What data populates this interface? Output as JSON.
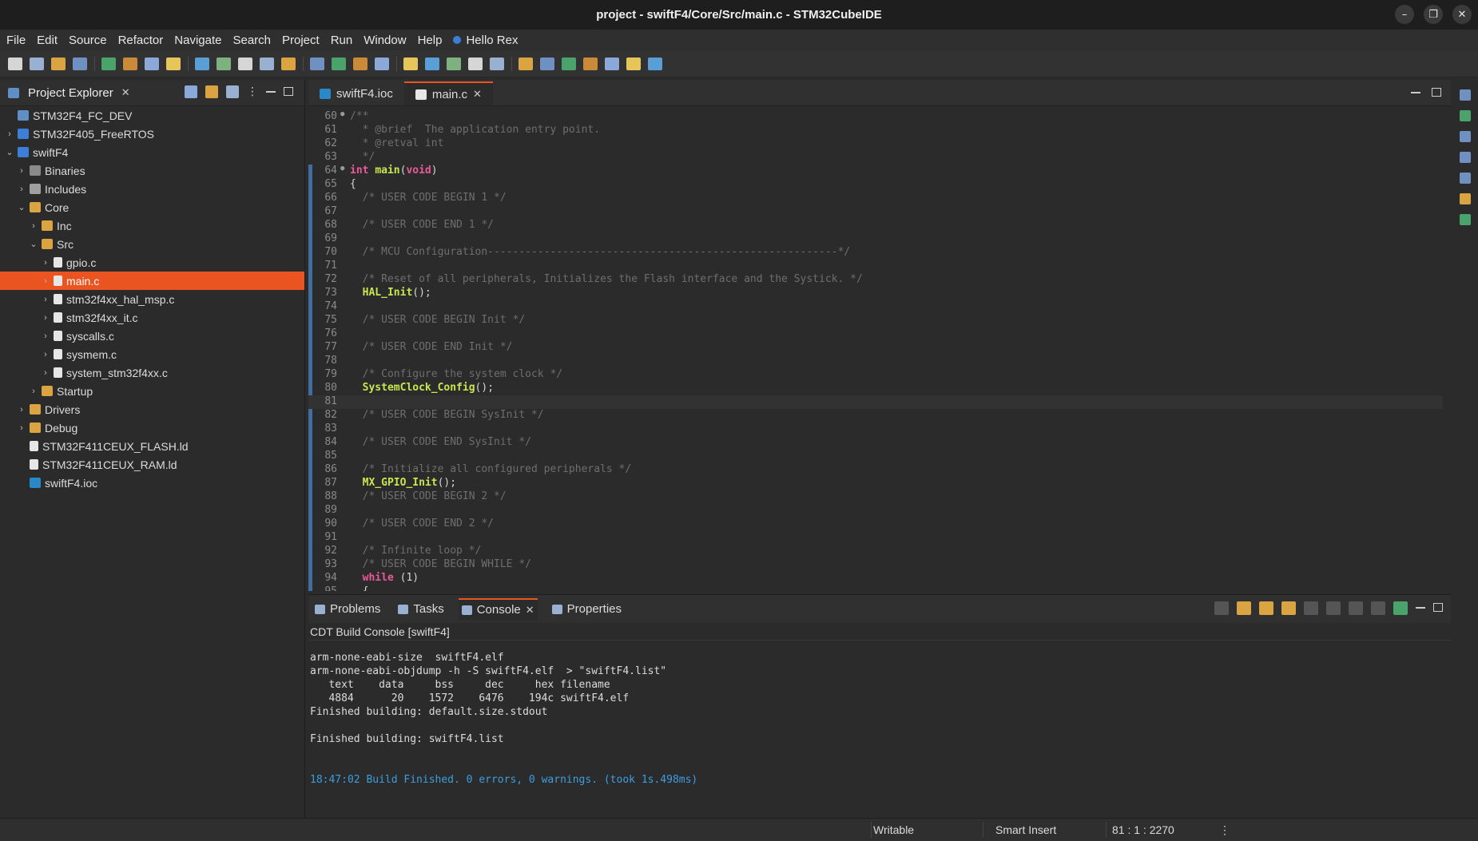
{
  "window": {
    "title": "project - swiftF4/Core/Src/main.c - STM32CubeIDE"
  },
  "menu": {
    "items": [
      "File",
      "Edit",
      "Source",
      "Refactor",
      "Navigate",
      "Search",
      "Project",
      "Run",
      "Window",
      "Help"
    ],
    "user": "Hello Rex"
  },
  "explorer": {
    "tab_label": "Project Explorer",
    "items": [
      {
        "label": "STM32F4_FC_DEV",
        "depth": 0,
        "chev": "",
        "icon": "proj"
      },
      {
        "label": "STM32F405_FreeRTOS",
        "depth": 0,
        "chev": "›",
        "icon": "ide"
      },
      {
        "label": "swiftF4",
        "depth": 0,
        "chev": "⌄",
        "icon": "ide"
      },
      {
        "label": "Binaries",
        "depth": 1,
        "chev": "›",
        "icon": "bin"
      },
      {
        "label": "Includes",
        "depth": 1,
        "chev": "›",
        "icon": "inc"
      },
      {
        "label": "Core",
        "depth": 1,
        "chev": "⌄",
        "icon": "folder"
      },
      {
        "label": "Inc",
        "depth": 2,
        "chev": "›",
        "icon": "folder"
      },
      {
        "label": "Src",
        "depth": 2,
        "chev": "⌄",
        "icon": "folder"
      },
      {
        "label": "gpio.c",
        "depth": 3,
        "chev": "›",
        "icon": "file"
      },
      {
        "label": "main.c",
        "depth": 3,
        "chev": "›",
        "icon": "file",
        "selected": true
      },
      {
        "label": "stm32f4xx_hal_msp.c",
        "depth": 3,
        "chev": "›",
        "icon": "file"
      },
      {
        "label": "stm32f4xx_it.c",
        "depth": 3,
        "chev": "›",
        "icon": "file"
      },
      {
        "label": "syscalls.c",
        "depth": 3,
        "chev": "›",
        "icon": "file"
      },
      {
        "label": "sysmem.c",
        "depth": 3,
        "chev": "›",
        "icon": "file"
      },
      {
        "label": "system_stm32f4xx.c",
        "depth": 3,
        "chev": "›",
        "icon": "file"
      },
      {
        "label": "Startup",
        "depth": 2,
        "chev": "›",
        "icon": "folder"
      },
      {
        "label": "Drivers",
        "depth": 1,
        "chev": "›",
        "icon": "folder"
      },
      {
        "label": "Debug",
        "depth": 1,
        "chev": "›",
        "icon": "folder"
      },
      {
        "label": "STM32F411CEUX_FLASH.ld",
        "depth": 1,
        "chev": "",
        "icon": "file"
      },
      {
        "label": "STM32F411CEUX_RAM.ld",
        "depth": 1,
        "chev": "",
        "icon": "file"
      },
      {
        "label": "swiftF4.ioc",
        "depth": 1,
        "chev": "",
        "icon": "mx"
      }
    ]
  },
  "editor": {
    "tabs": [
      {
        "label": "swiftF4.ioc",
        "active": false
      },
      {
        "label": "main.c",
        "active": true
      }
    ],
    "current_line": 81,
    "lines": [
      {
        "n": "60",
        "fold": true,
        "type": "comment",
        "text": "/**"
      },
      {
        "n": "61",
        "type": "comment",
        "text": "  * @brief  The application entry point."
      },
      {
        "n": "62",
        "type": "comment",
        "text": "  * @retval int"
      },
      {
        "n": "63",
        "type": "comment",
        "text": "  */"
      },
      {
        "n": "64",
        "fold": true,
        "type": "main",
        "text": "int main(void)"
      },
      {
        "n": "65",
        "type": "code",
        "text": "{"
      },
      {
        "n": "66",
        "type": "comment",
        "text": "  /* USER CODE BEGIN 1 */"
      },
      {
        "n": "67",
        "type": "code",
        "text": ""
      },
      {
        "n": "68",
        "type": "comment",
        "text": "  /* USER CODE END 1 */"
      },
      {
        "n": "69",
        "type": "code",
        "text": ""
      },
      {
        "n": "70",
        "type": "comment",
        "text": "  /* MCU Configuration--------------------------------------------------------*/"
      },
      {
        "n": "71",
        "type": "code",
        "text": ""
      },
      {
        "n": "72",
        "type": "comment",
        "text": "  /* Reset of all peripherals, Initializes the Flash interface and the Systick. */"
      },
      {
        "n": "73",
        "type": "call",
        "fn": "HAL_Init",
        "text": "();"
      },
      {
        "n": "74",
        "type": "code",
        "text": ""
      },
      {
        "n": "75",
        "type": "comment",
        "text": "  /* USER CODE BEGIN Init */"
      },
      {
        "n": "76",
        "type": "code",
        "text": ""
      },
      {
        "n": "77",
        "type": "comment",
        "text": "  /* USER CODE END Init */"
      },
      {
        "n": "78",
        "type": "code",
        "text": ""
      },
      {
        "n": "79",
        "type": "comment",
        "text": "  /* Configure the system clock */"
      },
      {
        "n": "80",
        "type": "call",
        "fn": "SystemClock_Config",
        "text": "();"
      },
      {
        "n": "81",
        "type": "code",
        "text": ""
      },
      {
        "n": "82",
        "type": "comment",
        "text": "  /* USER CODE BEGIN SysInit */"
      },
      {
        "n": "83",
        "type": "code",
        "text": ""
      },
      {
        "n": "84",
        "type": "comment",
        "text": "  /* USER CODE END SysInit */"
      },
      {
        "n": "85",
        "type": "code",
        "text": ""
      },
      {
        "n": "86",
        "type": "comment",
        "text": "  /* Initialize all configured peripherals */"
      },
      {
        "n": "87",
        "type": "call",
        "fn": "MX_GPIO_Init",
        "text": "();"
      },
      {
        "n": "88",
        "type": "comment",
        "text": "  /* USER CODE BEGIN 2 */"
      },
      {
        "n": "89",
        "type": "code",
        "text": ""
      },
      {
        "n": "90",
        "type": "comment",
        "text": "  /* USER CODE END 2 */"
      },
      {
        "n": "91",
        "type": "code",
        "text": ""
      },
      {
        "n": "92",
        "type": "comment",
        "text": "  /* Infinite loop */"
      },
      {
        "n": "93",
        "type": "comment",
        "text": "  /* USER CODE BEGIN WHILE */"
      },
      {
        "n": "94",
        "type": "while",
        "text": " (1)"
      },
      {
        "n": "95",
        "type": "code",
        "text": "  {"
      }
    ]
  },
  "console": {
    "tabs": [
      {
        "label": "Problems",
        "active": false
      },
      {
        "label": "Tasks",
        "active": false
      },
      {
        "label": "Console",
        "active": true
      },
      {
        "label": "Properties",
        "active": false
      }
    ],
    "header": "CDT Build Console [swiftF4]",
    "lines": [
      "arm-none-eabi-size  swiftF4.elf",
      "arm-none-eabi-objdump -h -S swiftF4.elf  > \"swiftF4.list\"",
      "   text    data     bss     dec     hex filename",
      "   4884      20    1572    6476    194c swiftF4.elf",
      "Finished building: default.size.stdout",
      "",
      "Finished building: swiftF4.list",
      "",
      ""
    ],
    "status_line": "18:47:02 Build Finished. 0 errors, 0 warnings. (took 1s.498ms)"
  },
  "status": {
    "writable": "Writable",
    "insert_mode": "Smart Insert",
    "position": "81 : 1 : 2270"
  },
  "colors": {
    "accent": "#e95420",
    "keyword": "#e85a9a",
    "function": "#c8e650",
    "comment": "#6e6e6e",
    "console_status": "#3c9ee0"
  }
}
